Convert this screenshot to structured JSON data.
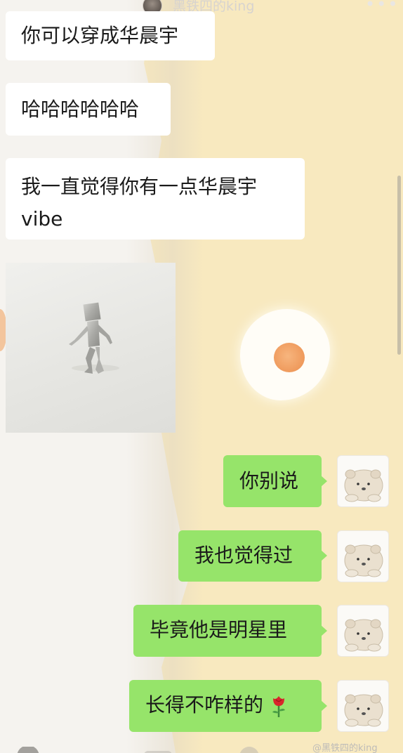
{
  "header": {
    "contact_name": "黑铁四的king",
    "more_icon": "more-dots-icon",
    "more_symbol": "•••"
  },
  "messages": [
    {
      "side": "in",
      "text": "你可以穿成华晨宇"
    },
    {
      "side": "in",
      "text": "哈哈哈哈哈哈"
    },
    {
      "side": "in",
      "lines": [
        "我一直觉得你有一点华晨宇",
        "vibe"
      ]
    },
    {
      "side": "in",
      "type": "image",
      "description_icon": "figure-sculpture-image"
    },
    {
      "side": "out",
      "text": "你别说"
    },
    {
      "side": "out",
      "text": "我也觉得过"
    },
    {
      "side": "out",
      "text": "毕竟他是明星里"
    },
    {
      "side": "out",
      "text": "长得不咋样的",
      "emoji": "rose-icon"
    }
  ],
  "self_avatar_icon": "bear-avatar-icon",
  "watermark": "@黑铁四的king",
  "colors": {
    "outgoing_bubble": "#96e46a",
    "incoming_bubble": "#ffffff",
    "wallpaper_cream": "#f8e9bf"
  }
}
